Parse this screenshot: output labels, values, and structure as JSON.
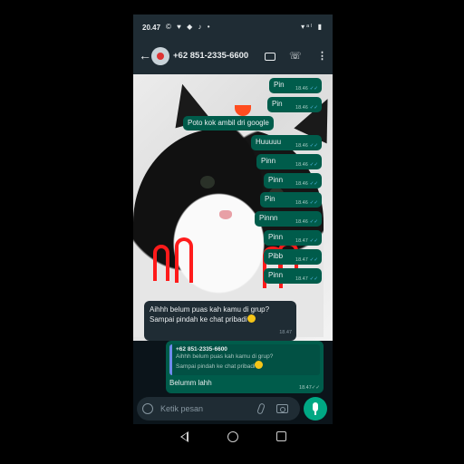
{
  "status_bar": {
    "time": "20.47",
    "left_icons": "© ♥ ◆ ♪ •",
    "right_icons": "▾ᵃˡ ▮"
  },
  "header": {
    "contact": "+62 851-2335-6600"
  },
  "messages": [
    {
      "text": "Pin",
      "time": "18.46"
    },
    {
      "text": "Pin",
      "time": "18.46"
    },
    {
      "text": "Poto kok ambil dri google",
      "time": ""
    },
    {
      "text": "Huuuuu",
      "time": "18.46"
    },
    {
      "text": "Pinn",
      "time": "18.46"
    },
    {
      "text": "Pinn",
      "time": "18.46"
    },
    {
      "text": "Pin",
      "time": "18.46"
    },
    {
      "text": "Pinnn",
      "time": "18.46"
    },
    {
      "text": "Pinn",
      "time": "18.47"
    },
    {
      "text": "Pibb",
      "time": "18.47"
    },
    {
      "text": "Pinn",
      "time": "18.47"
    }
  ],
  "incoming": {
    "line1": "Aihhh belum puas kah kamu di grup?",
    "line2": "Sampai pindah ke chat pribadi",
    "time": "18.47"
  },
  "reply": {
    "quote_name": "+62 851-2335-6600",
    "quote_line1": "Aihhh belum puas kah kamu di grup?",
    "quote_line2": "Sampai pindah ke chat pribadi",
    "text": "Belumm lahh",
    "time": "18.47"
  },
  "input": {
    "placeholder": "Ketik pesan"
  },
  "colors": {
    "outgoing": "#005c4b",
    "incoming": "#1f2c34",
    "accent": "#00a884",
    "ticks": "#53bdeb"
  }
}
